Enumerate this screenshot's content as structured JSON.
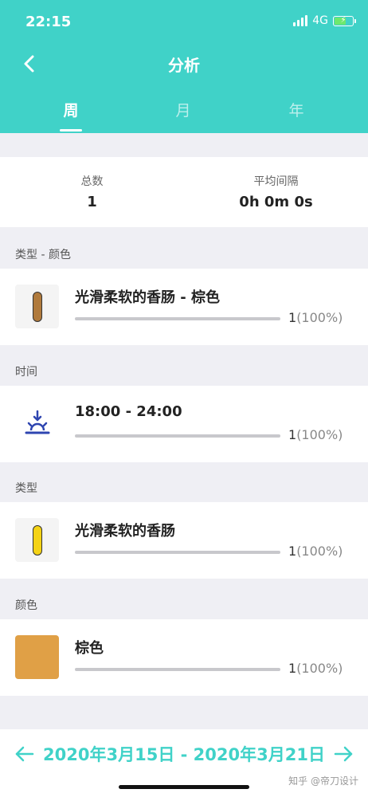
{
  "status_bar": {
    "time": "22:15",
    "network": "4G"
  },
  "nav": {
    "title": "分析"
  },
  "tabs": [
    {
      "label": "周",
      "active": true
    },
    {
      "label": "月",
      "active": false
    },
    {
      "label": "年",
      "active": false
    }
  ],
  "summary": {
    "total_label": "总数",
    "total_value": "1",
    "interval_label": "平均间隔",
    "interval_value": "0h 0m 0s"
  },
  "sections": [
    {
      "label": "类型 - 颜色",
      "item_title": "光滑柔软的香肠 - 棕色",
      "count": "1",
      "percent": "(100%)",
      "icon": "brown-capsule-icon",
      "fill": 1.0
    },
    {
      "label": "时间",
      "item_title": "18:00 - 24:00",
      "count": "1",
      "percent": "(100%)",
      "icon": "sunset-icon",
      "fill": 1.0
    },
    {
      "label": "类型",
      "item_title": "光滑柔软的香肠",
      "count": "1",
      "percent": "(100%)",
      "icon": "yellow-capsule-icon",
      "fill": 1.0
    },
    {
      "label": "颜色",
      "item_title": "棕色",
      "count": "1",
      "percent": "(100%)",
      "icon": "color-swatch-icon",
      "fill": 1.0
    }
  ],
  "colors": {
    "accent": "#40d2c8",
    "brown_capsule": "#b07a3c",
    "yellow_capsule": "#f5d315",
    "swatch": "#e0a046",
    "sunset_icon": "#2e45b0"
  },
  "footer": {
    "date_range": "2020年3月15日 - 2020年3月21日",
    "watermark": "知乎 @帝刀设计"
  }
}
